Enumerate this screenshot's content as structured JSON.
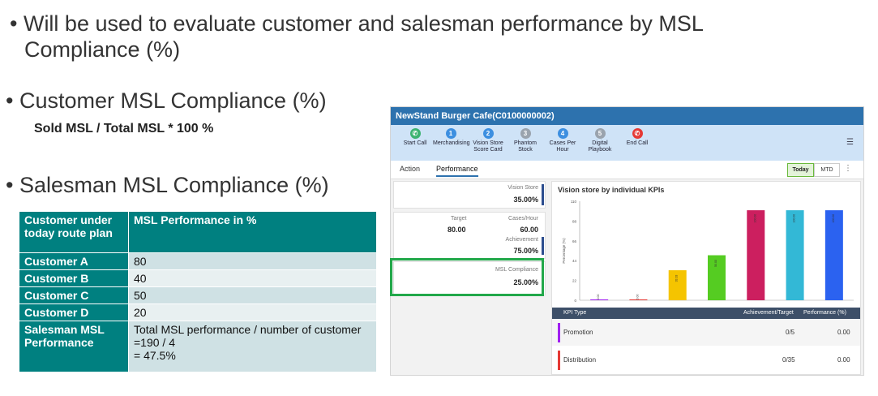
{
  "slide": {
    "bullet1_line1": "• Will be used to evaluate customer and salesman performance by MSL",
    "bullet1_line2": "Compliance (%)",
    "bullet2": "• Customer MSL Compliance (%)",
    "formula": "Sold MSL / Total MSL * 100 %",
    "bullet3": "• Salesman MSL Compliance (%)"
  },
  "table": {
    "header": [
      "Customer under today route plan",
      "MSL Performance in %"
    ],
    "rows": [
      [
        "Customer A",
        "80"
      ],
      [
        "Customer B",
        "40"
      ],
      [
        "Customer C",
        "50"
      ],
      [
        "Customer D",
        "20"
      ]
    ],
    "summary_label": "Salesman MSL Performance",
    "summary_lines": [
      "Total MSL performance / number of customer",
      "=190 / 4",
      "= 47.5%"
    ]
  },
  "app": {
    "title": "NewStand Burger Cafe(C0100000002)",
    "toolbar": [
      {
        "label": "Start Call",
        "icon": "phone-icon",
        "color": "#3cb371",
        "badge": "✆"
      },
      {
        "label": "Merchandising",
        "icon": "merchandising-icon",
        "color": "#3d8fe0",
        "badge": "1"
      },
      {
        "label": "Vision Store Score Card",
        "icon": "scorecard-icon",
        "color": "#3d8fe0",
        "badge": "2"
      },
      {
        "label": "Phantom Stock",
        "icon": "phantom-stock-icon",
        "color": "#9aa3ad",
        "badge": "3"
      },
      {
        "label": "Cases Per Hour",
        "icon": "cases-per-hour-icon",
        "color": "#3d8fe0",
        "badge": "4"
      },
      {
        "label": "Digital Playbook",
        "icon": "playbook-icon",
        "color": "#9aa3ad",
        "badge": "5"
      },
      {
        "label": "End Call",
        "icon": "end-call-icon",
        "color": "#e53935",
        "badge": "✆"
      }
    ],
    "tabs": [
      "Action",
      "Performance"
    ],
    "periods": [
      "Today",
      "MTD"
    ],
    "kpis": {
      "vision_store_label": "Vision Store",
      "vision_store_value": "35.00%",
      "target_label": "Target",
      "target_value": "80.00",
      "cases_label": "Cases/Hour",
      "cases_value": "60.00",
      "achievement_label": "Achievement",
      "achievement_value": "75.00%",
      "msl_label": "MSL Compliance",
      "msl_value": "25.00%"
    },
    "chart_title": "Vision store by individual KPIs",
    "kpi_table": {
      "headers": [
        "KPI Type",
        "Achievement/Target",
        "Performance (%)"
      ],
      "rows": [
        {
          "name": "Promotion",
          "achievement": "0/5",
          "performance": "0.00",
          "color": "#a020f0"
        },
        {
          "name": "Distribution",
          "achievement": "0/35",
          "performance": "0.00",
          "color": "#e53935"
        }
      ]
    }
  },
  "chart_data": {
    "type": "bar",
    "title": "Vision store by individual KPIs",
    "ylabel": "Percentage (%)",
    "ylim": [
      0,
      110
    ],
    "yticks": [
      0,
      22,
      44,
      66,
      88,
      110
    ],
    "values": [
      0,
      0,
      33.33,
      50,
      100,
      100,
      100
    ],
    "colors": [
      "#a020f0",
      "#e53935",
      "#f5c400",
      "#55cc22",
      "#cc1f5f",
      "#33b8d6",
      "#2b62f0"
    ],
    "grid": false
  }
}
